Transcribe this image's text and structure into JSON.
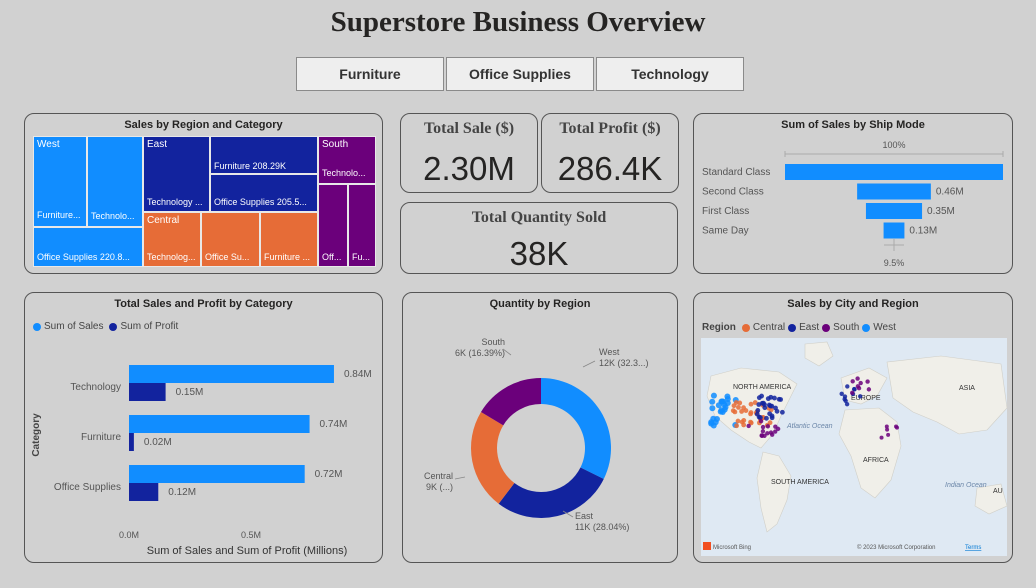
{
  "page": {
    "title": "Superstore Business Overview"
  },
  "slicer": {
    "items": [
      "Furniture",
      "Office Supplies",
      "Technology"
    ]
  },
  "kpis": {
    "total_sale": {
      "label": "Total Sale ($)",
      "value": "2.30M"
    },
    "total_profit": {
      "label": "Total Profit ($)",
      "value": "286.4K"
    },
    "total_quantity": {
      "label": "Total Quantity Sold",
      "value": "38K"
    }
  },
  "colors": {
    "west": "#118dff",
    "east": "#12239e",
    "central": "#e66c37",
    "south": "#6b007b",
    "furniture_east": "#0f1f9c"
  },
  "treemap": {
    "title": "Sales by Region and Category",
    "west": "West",
    "west_furniture": "Furniture...",
    "west_technology": "Technolo...",
    "west_office": "Office Supplies 220.8...",
    "east": "East",
    "east_furniture": "Furniture 208.29K",
    "east_technology": "Technology ...",
    "east_office": "Office Supplies 205.5...",
    "central": "Central",
    "central_technology": "Technolog...",
    "central_office": "Office Su...",
    "central_furniture": "Furniture ...",
    "south": "South",
    "south_technology": "Technolo...",
    "south_office": "Off...",
    "south_furniture": "Fu..."
  },
  "ship_mode": {
    "title": "Sum of Sales by Ship Mode",
    "top_label": "100%",
    "bottom_label": "9.5%",
    "chart_data": {
      "type": "bar",
      "categories": [
        "Standard Class",
        "Second Class",
        "First Class",
        "Same Day"
      ],
      "values": [
        1.36,
        0.46,
        0.35,
        0.13
      ],
      "value_labels": [
        "",
        "0.46M",
        "0.35M",
        "0.13M"
      ]
    }
  },
  "cat_chart": {
    "title": "Total Sales and Profit by Category",
    "legend_sales": "Sum of Sales",
    "legend_profit": "Sum of Profit",
    "xlabel": "Sum of Sales and Sum of Profit (Millions)",
    "ylabel": "Category",
    "ticks": [
      "0.0M",
      "0.5M"
    ],
    "chart_data": {
      "type": "bar",
      "categories": [
        "Technology",
        "Furniture",
        "Office Supplies"
      ],
      "series": [
        {
          "name": "Sum of Sales",
          "values": [
            0.84,
            0.74,
            0.72
          ],
          "labels": [
            "0.84M",
            "0.74M",
            "0.72M"
          ]
        },
        {
          "name": "Sum of Profit",
          "values": [
            0.15,
            0.02,
            0.12
          ],
          "labels": [
            "0.15M",
            "0.02M",
            "0.12M"
          ]
        }
      ],
      "xlim": [
        0,
        0.9
      ]
    }
  },
  "quantity": {
    "title": "Quantity by Region",
    "chart_data": {
      "type": "pie",
      "categories": [
        "West",
        "East",
        "Central",
        "South"
      ],
      "values": [
        32.3,
        28.04,
        23.27,
        16.39
      ],
      "labels_line1": [
        "West",
        "East",
        "Central",
        "South"
      ],
      "labels_line2": [
        "12K (32.3...)",
        "11K (28.04%)",
        "9K (...)",
        "6K (16.39%)"
      ]
    }
  },
  "map": {
    "title": "Sales by City and Region",
    "legend_title": "Region",
    "legend": [
      "Central",
      "East",
      "South",
      "West"
    ],
    "labels": {
      "north_america": "NORTH AMERICA",
      "europe": "EUROPE",
      "asia": "ASIA",
      "africa": "AFRICA",
      "south_america": "SOUTH AMERICA",
      "atlantic": "Atlantic Ocean",
      "indian": "Indian Ocean",
      "aus": "AU"
    },
    "bing": "Microsoft Bing",
    "copyright": "© 2023 Microsoft Corporation",
    "terms": "Terms"
  }
}
